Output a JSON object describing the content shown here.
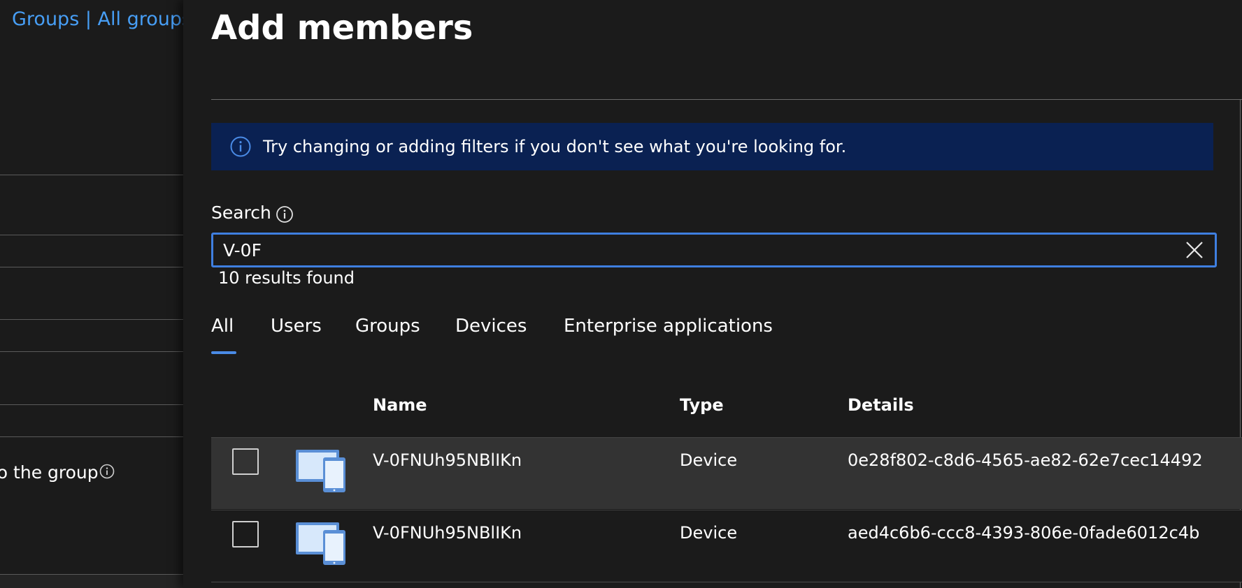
{
  "background": {
    "breadcrumb": "Groups | All groups",
    "partial_text": "to the group"
  },
  "panel": {
    "title": "Add members",
    "info_message": "Try changing or adding filters if you don't see what you're looking for.",
    "search": {
      "label": "Search",
      "value": "V-0F",
      "results_text": "10 results found"
    },
    "tabs": [
      {
        "label": "All",
        "selected": true
      },
      {
        "label": "Users",
        "selected": false
      },
      {
        "label": "Groups",
        "selected": false
      },
      {
        "label": "Devices",
        "selected": false
      },
      {
        "label": "Enterprise applications",
        "selected": false
      }
    ],
    "table": {
      "columns": [
        "Name",
        "Type",
        "Details"
      ],
      "rows": [
        {
          "name": "V-0FNUh95NBlIKn",
          "type": "Device",
          "details": "0e28f802-c8d6-4565-ae82-62e7cec14492",
          "checked": false
        },
        {
          "name": "V-0FNUh95NBlIKn",
          "type": "Device",
          "details": "aed4c6b6-ccc8-4393-806e-0fade6012c4b",
          "checked": false
        }
      ]
    }
  },
  "colors": {
    "link": "#479ef5",
    "accent": "#3f7fe0",
    "info_bar": "#0a2152",
    "background": "#1b1b1b",
    "selected_row": "#333333"
  },
  "icons": [
    "info-icon",
    "close-icon",
    "device-icon"
  ]
}
